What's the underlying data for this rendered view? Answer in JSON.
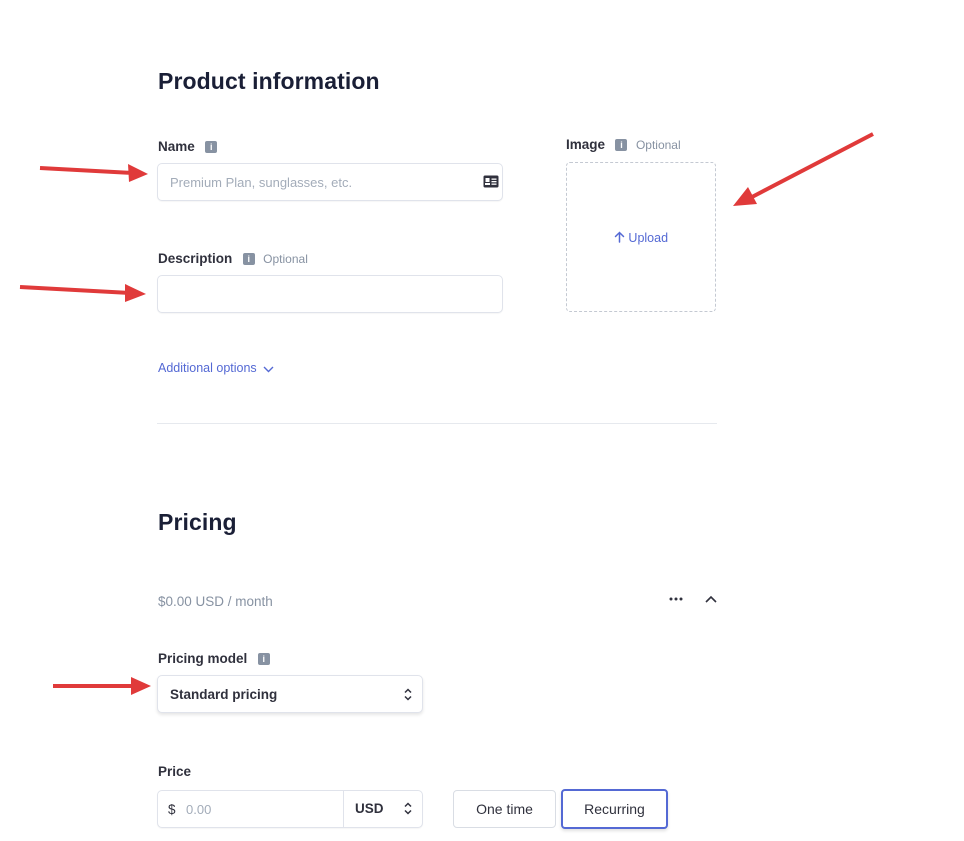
{
  "product_info": {
    "title": "Product information",
    "name_label": "Name",
    "name_placeholder": "Premium Plan, sunglasses, etc.",
    "description_label": "Description",
    "description_optional": "Optional",
    "image_label": "Image",
    "image_optional": "Optional",
    "upload_label": "Upload",
    "additional_options": "Additional options"
  },
  "pricing": {
    "title": "Pricing",
    "summary": "$0.00 USD / month",
    "pricing_model_label": "Pricing model",
    "pricing_model_value": "Standard pricing",
    "price_label": "Price",
    "currency_symbol": "$",
    "price_placeholder": "0.00",
    "currency": "USD",
    "one_time_label": "One time",
    "recurring_label": "Recurring",
    "selected_billing": "Recurring"
  },
  "colors": {
    "accent": "#5469d4",
    "annotation_arrow": "#e03a3a"
  },
  "icons": [
    "info-icon",
    "contact-card-icon",
    "upload-arrow-icon",
    "chevron-down-icon",
    "more-dots-icon",
    "chevron-up-icon",
    "select-updown-icon"
  ]
}
